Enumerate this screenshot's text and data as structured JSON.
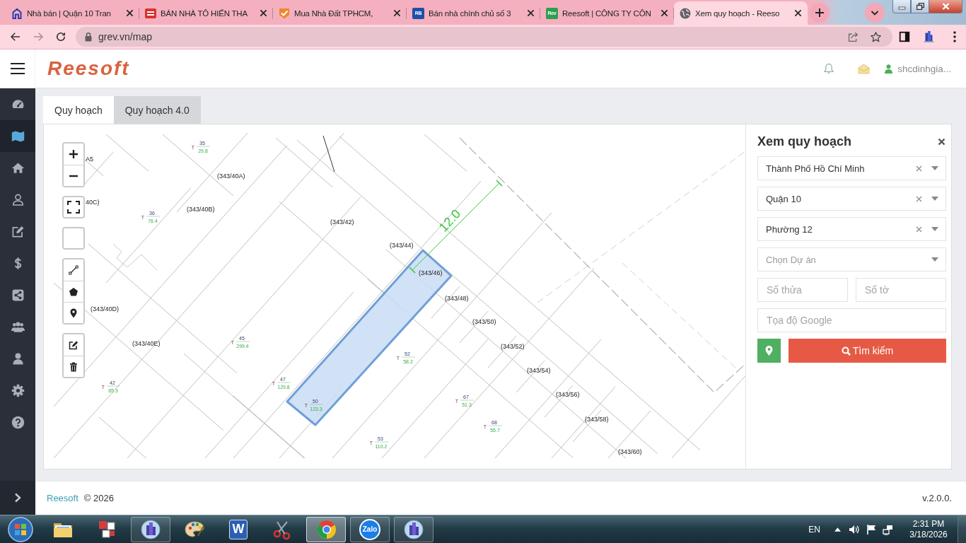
{
  "browser": {
    "tabs": [
      {
        "title": "Nhà bán | Quận 10 Tran",
        "kind": "house",
        "selected": false
      },
      {
        "title": "BÁN NHÀ TÔ HIẾN THA",
        "kind": "banner",
        "selected": false
      },
      {
        "title": "Mua Nhà Đất TPHCM,",
        "kind": "badge",
        "selected": false
      },
      {
        "title": "Bán nhà chính chủ số 3",
        "kind": "logo",
        "favicon_text": "RB",
        "color": "#1f4fa8",
        "selected": false
      },
      {
        "title": "Reesoft | CÔNG TY CÔN",
        "kind": "logo",
        "favicon_text": "Rev",
        "color": "#2e9e50",
        "selected": false
      },
      {
        "title": "Xem quy hoạch - Reeso",
        "kind": "globe",
        "selected": true
      }
    ],
    "nav_buttons": [
      {
        "kind": "back",
        "disabled": false
      },
      {
        "kind": "forward",
        "disabled": true
      },
      {
        "kind": "reload",
        "disabled": false
      }
    ],
    "url": "grev.vn/map"
  },
  "header": {
    "logo": "Reesoft",
    "user": "shcdinhgia..."
  },
  "sidebar": {
    "items": [
      {
        "kind": "dashboard",
        "selected": false
      },
      {
        "kind": "map",
        "selected": true
      },
      {
        "kind": "home",
        "selected": false
      },
      {
        "kind": "profile",
        "selected": false
      },
      {
        "kind": "edit",
        "selected": false
      },
      {
        "kind": "money",
        "selected": false
      },
      {
        "kind": "share",
        "selected": false
      },
      {
        "kind": "team",
        "selected": false
      },
      {
        "kind": "user",
        "selected": false
      },
      {
        "kind": "settings",
        "selected": false
      },
      {
        "kind": "help",
        "selected": false
      }
    ]
  },
  "page_tabs": [
    {
      "label": "Quy hoạch",
      "selected": true
    },
    {
      "label": "Quy hoạch 4.0",
      "selected": false
    }
  ],
  "map": {
    "street_labels": [
      "A5",
      "40C)",
      "(343/40A)",
      "(343/40B)",
      "(343/42)",
      "(343/40D)",
      "(343/40E)",
      "(343/44)",
      "(343/46)",
      "(343/48)",
      "(343/50)",
      "(343/52)",
      "(343/54)",
      "(343/56)",
      "(343/58)",
      "(343/60)"
    ],
    "lots": [
      {
        "type": "T",
        "number": "35",
        "area": "29.8"
      },
      {
        "type": "T",
        "number": "36",
        "area": "76.4"
      },
      {
        "type": "T",
        "number": "45",
        "area": "299.4"
      },
      {
        "type": "T",
        "number": "42",
        "area": "65.3"
      },
      {
        "type": "T",
        "number": "47",
        "area": "129.8"
      },
      {
        "type": "T",
        "number": "50",
        "area": "123.3"
      },
      {
        "type": "T",
        "number": "52",
        "area": "58.2"
      },
      {
        "type": "T",
        "number": "67",
        "area": "51.3"
      },
      {
        "type": "T",
        "number": "68",
        "area": "55.7"
      },
      {
        "type": "T",
        "number": "53",
        "area": "110.2"
      }
    ],
    "dimension": {
      "label": "12.0"
    }
  },
  "search_panel": {
    "title": "Xem quy hoạch",
    "selects": [
      {
        "value": "Thành Phố Hồ Chí Minh"
      },
      {
        "value": "Quận 10"
      },
      {
        "value": "Phường 12"
      },
      {
        "placeholder": "Chọn Dự án"
      }
    ],
    "parcel_fields": [
      {
        "placeholder": "Số thửa"
      },
      {
        "placeholder": "Số tờ"
      }
    ],
    "coordinates_field": {
      "placeholder": "Tọa độ Google"
    },
    "search_button": {
      "label": "Tìm kiếm"
    }
  },
  "footer": {
    "brand": "Reesoft",
    "copyright": "© 2026",
    "version": "v.2.0.0."
  },
  "taskbar": {
    "items": [
      {
        "kind": "folder",
        "running": false,
        "selected": false
      },
      {
        "kind": "tiles",
        "running": false,
        "selected": false
      },
      {
        "kind": "building",
        "running": true,
        "selected": false
      },
      {
        "kind": "palette",
        "running": false,
        "selected": false
      },
      {
        "kind": "word",
        "text": "W",
        "running": false,
        "selected": false
      },
      {
        "kind": "scissors",
        "running": false,
        "selected": false
      },
      {
        "kind": "browser",
        "running": true,
        "selected": true
      },
      {
        "kind": "chat",
        "text": "Zalo",
        "running": true,
        "selected": false
      },
      {
        "kind": "building",
        "running": true,
        "selected": false
      }
    ],
    "language": "EN",
    "time": "2:31 PM",
    "date": "3/18/2026"
  }
}
